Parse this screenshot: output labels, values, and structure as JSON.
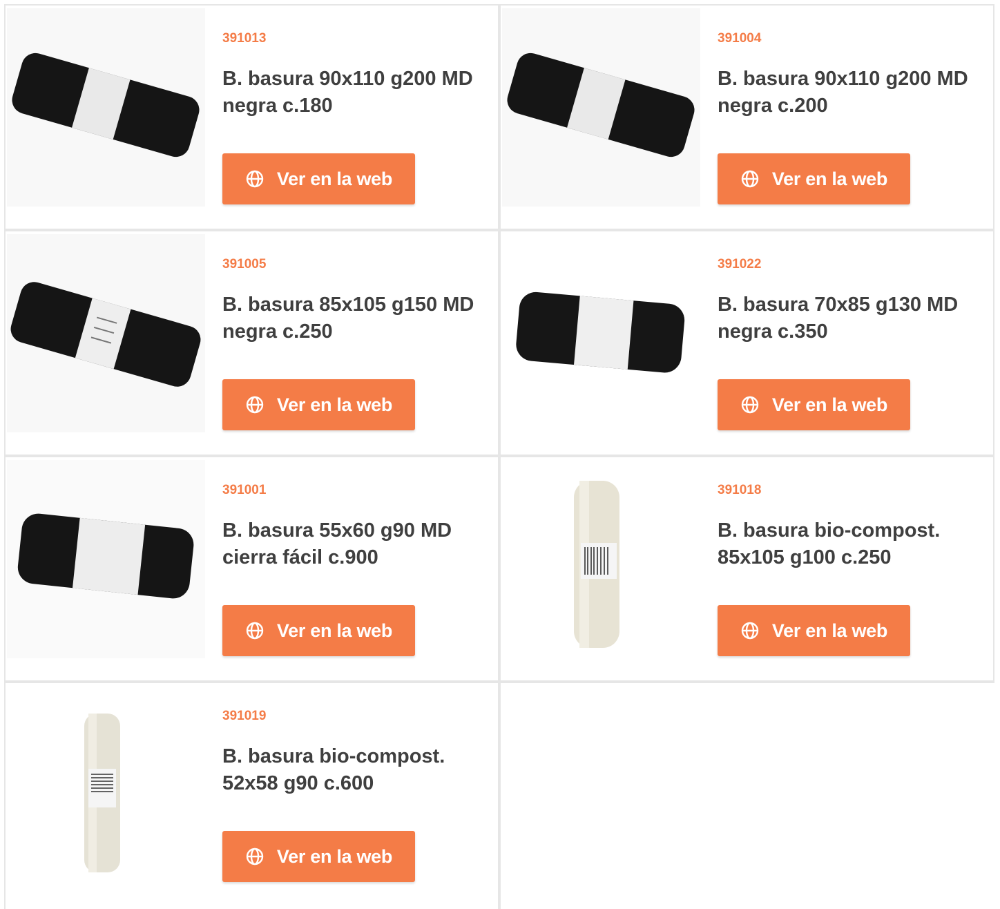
{
  "products": [
    {
      "code": "391013",
      "title": "B. basura 90x110 g200 MD negra c.180",
      "button_label": "Ver en la web",
      "image_icon": "black-bag-roll-icon"
    },
    {
      "code": "391004",
      "title": "B. basura 90x110 g200 MD negra c.200",
      "button_label": "Ver en la web",
      "image_icon": "black-bag-roll-icon"
    },
    {
      "code": "391005",
      "title": "B. basura 85x105 g150 MD negra c.250",
      "button_label": "Ver en la web",
      "image_icon": "black-bag-roll-icon"
    },
    {
      "code": "391022",
      "title": "B. basura 70x85 g130 MD negra c.350",
      "button_label": "Ver en la web",
      "image_icon": "black-bag-roll-icon"
    },
    {
      "code": "391001",
      "title": "B. basura 55x60 g90 MD cierra fácil c.900",
      "button_label": "Ver en la web",
      "image_icon": "black-bag-roll-icon"
    },
    {
      "code": "391018",
      "title": "B. basura bio-compost. 85x105 g100 c.250",
      "button_label": "Ver en la web",
      "image_icon": "compost-bag-roll-icon"
    },
    {
      "code": "391019",
      "title": "B. basura bio-compost. 52x58 g90 c.600",
      "button_label": "Ver en la web",
      "image_icon": "compost-bag-roll-icon"
    }
  ],
  "colors": {
    "accent": "#f47c47",
    "title_text": "#3f3f3f",
    "border": "#e6e6e6"
  }
}
